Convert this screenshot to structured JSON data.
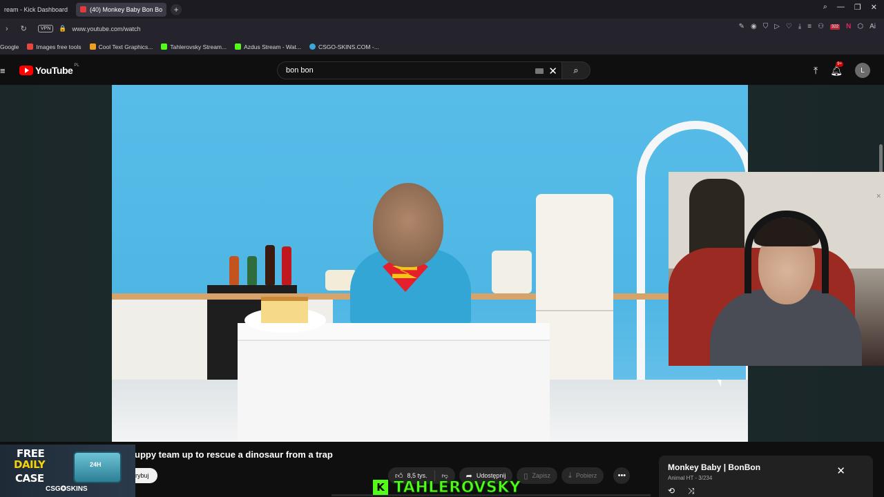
{
  "browser": {
    "tabs": [
      {
        "label": "ream - Kick Dashboard",
        "active": false
      },
      {
        "label": "(40) Monkey Baby Bon Bo",
        "active": true
      }
    ],
    "new_tab": "+",
    "url": "www.youtube.com/watch",
    "vpn_label": "VPN",
    "extension_badge": "322",
    "ai_label": "Ai",
    "bookmarks": [
      {
        "label": "Google",
        "color": "#4285f4"
      },
      {
        "label": "Images free tools",
        "color": "#e8453c"
      },
      {
        "label": "Cool Text Graphics...",
        "color": "#f0a020"
      },
      {
        "label": "Tahlerovsky Stream...",
        "color": "#53fc18"
      },
      {
        "label": "Azdus Stream - Wat...",
        "color": "#53fc18"
      },
      {
        "label": "CSGO-SKINS.COM -...",
        "color": "#3aa7d8"
      }
    ]
  },
  "youtube": {
    "logo_text": "YouTube",
    "region": "PL",
    "search_value": "bon bon",
    "notifications_badge": "9+",
    "avatar_letter": "L",
    "video_title": "uppy team up to rescue a dinosaur from a trap",
    "subscribe_partial": "rybuj",
    "actions": {
      "likes": "8,5 tys.",
      "share": "Udostępnij",
      "save": "Zapisz",
      "download": "Pobierz"
    },
    "miniplayer": {
      "title": "Monkey Baby | BonBon",
      "subtitle": "Animal HT - 3/234"
    }
  },
  "overlays": {
    "promo": {
      "line1": "FREE",
      "line2": "DAILY",
      "line3": "CASE",
      "chest_label": "24H",
      "brand": "CSG✪SKINS"
    },
    "streamer": {
      "k": "K",
      "name": "TAHLEROVSKY"
    }
  },
  "colors": {
    "accent_red": "#ff0000",
    "kick_green": "#53fc18"
  }
}
